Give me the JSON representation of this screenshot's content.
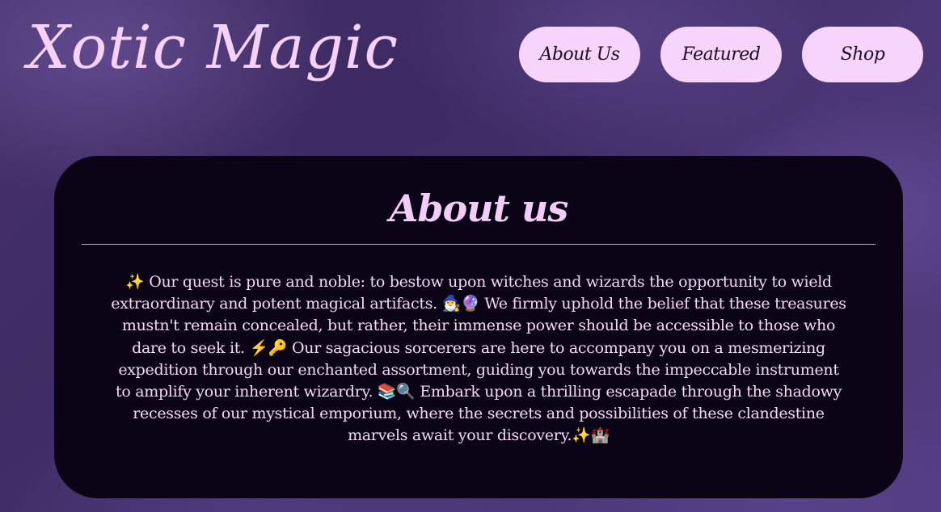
{
  "header": {
    "logo": "Xotic Magic",
    "nav": [
      {
        "label": "About Us"
      },
      {
        "label": "Featured"
      },
      {
        "label": "Shop"
      }
    ]
  },
  "about": {
    "title": "About us",
    "body": "✨ Our quest is pure and noble: to bestow upon witches and wizards the opportunity to wield extraordinary and potent magical artifacts. 🧙‍♂️🔮 We firmly uphold the belief that these treasures mustn't remain concealed, but rather, their immense power should be accessible to those who dare to seek it. ⚡🔑 Our sagacious sorcerers are here to accompany you on a mesmerizing expedition through our enchanted assortment, guiding you towards the impeccable instrument to amplify your inherent wizardry. 📚🔍 Embark upon a thrilling escapade through the shadowy recesses of our mystical emporium, where the secrets and possibilities of these clandestine marvels await your discovery.✨🏰"
  },
  "colors": {
    "background": "#4a3672",
    "accent": "#f6d4fb",
    "card": "#0b0416",
    "nav_text": "#1c0e2a"
  }
}
